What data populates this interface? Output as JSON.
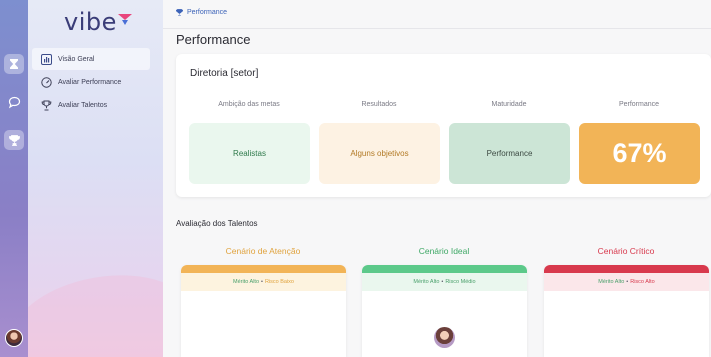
{
  "app": {
    "logo_text": "vibe"
  },
  "colors": {
    "brand_pink": "#e8457c",
    "brand_blue": "#4a6fd6",
    "accent_orange": "#f2b457",
    "green": "#5cc98a",
    "red": "#d8394d"
  },
  "rail": {
    "items": [
      {
        "icon": "hourglass-icon",
        "active": true
      },
      {
        "icon": "chat-bubble-icon",
        "active": false
      },
      {
        "icon": "trophy-icon",
        "active": true
      }
    ],
    "avatar": "user-avatar"
  },
  "sidebar": {
    "items": [
      {
        "label": "Visão Geral",
        "icon": "bar-chart-icon",
        "active": true
      },
      {
        "label": "Avaliar Performance",
        "icon": "gauge-icon",
        "active": false
      },
      {
        "label": "Avaliar Talentos",
        "icon": "trophy-icon",
        "active": false
      }
    ]
  },
  "breadcrumb": {
    "label": "Performance",
    "icon": "trophy-icon"
  },
  "page": {
    "title": "Performance"
  },
  "summary": {
    "title": "Diretoria [setor]",
    "columns": [
      {
        "label": "Ambição das metas",
        "value": "Realistas",
        "bg": "#eaf7ee",
        "fg": "#2f7a4b"
      },
      {
        "label": "Resultados",
        "value": "Alguns objetivos",
        "bg": "#fdf2e3",
        "fg": "#b27a25"
      },
      {
        "label": "Maturidade",
        "value": "Performance",
        "bg": "#cce5d6",
        "fg": "#3c4a43"
      },
      {
        "label": "Performance",
        "value": "67%",
        "bg": "#f2b457",
        "fg": "#ffffff"
      }
    ]
  },
  "talents": {
    "title": "Avaliação dos Talentos",
    "scenarios": [
      {
        "title": "Cenário de Atenção",
        "title_color": "#e0a33e",
        "bar": "#f2b457",
        "sub_bg": "#fdf3df",
        "merit": "Mérito Alto",
        "risk": "Risco Baixo",
        "merit_color": "#4aa06b",
        "risk_color": "#e0a33e"
      },
      {
        "title": "Cenário Ideal",
        "title_color": "#3fa866",
        "bar": "#5cc98a",
        "sub_bg": "#eaf7ee",
        "merit": "Mérito Alto",
        "risk": "Risco Médio",
        "merit_color": "#4aa06b",
        "risk_color": "#4aa06b"
      },
      {
        "title": "Cenário Crítico",
        "title_color": "#d8394d",
        "bar": "#d8394d",
        "sub_bg": "#fbe7ea",
        "merit": "Mérito Alto",
        "risk": "Risco Alto",
        "merit_color": "#4aa06b",
        "risk_color": "#d8394d"
      }
    ]
  }
}
